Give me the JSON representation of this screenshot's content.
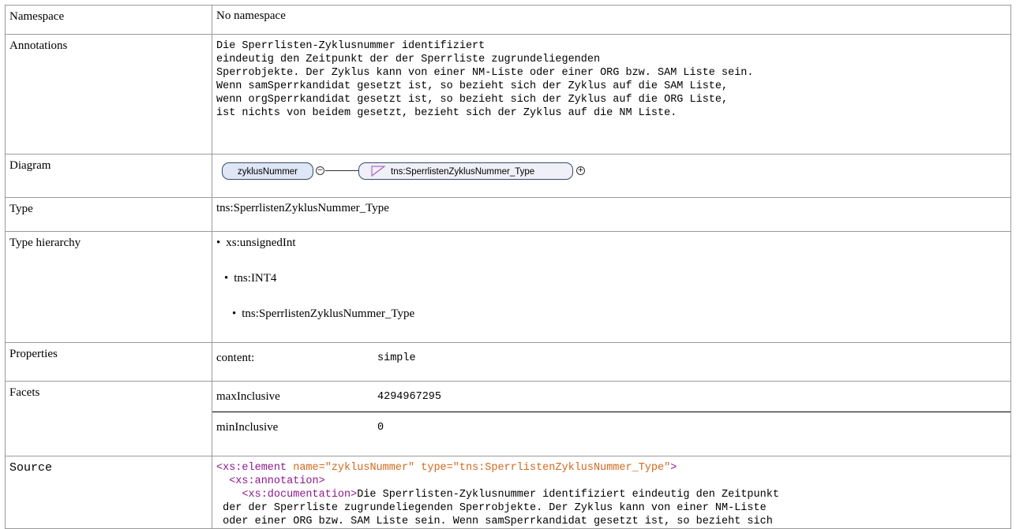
{
  "rows": {
    "namespace": {
      "label": "Namespace",
      "value": "No namespace"
    },
    "annotations": {
      "label": "Annotations",
      "text": "Die Sperrlisten-Zyklusnummer identifiziert\neindeutig den Zeitpunkt der der Sperrliste zugrundeliegenden\nSperrobjekte. Der Zyklus kann von einer NM-Liste oder einer ORG bzw. SAM Liste sein.\nWenn samSperrkandidat gesetzt ist, so bezieht sich der Zyklus auf die SAM Liste,\nwenn orgSperrkandidat gesetzt ist, so bezieht sich der Zyklus auf die ORG Liste,\nist nichts von beidem gesetzt, bezieht sich der Zyklus auf die NM Liste."
    },
    "diagram": {
      "label": "Diagram",
      "element": "zyklusNummer",
      "type_box": "tns:SperrlistenZyklusNummer_Type",
      "icons": [
        "minus-icon",
        "plus-icon",
        "simple-type-icon"
      ]
    },
    "type": {
      "label": "Type",
      "value": "tns:SperrlistenZyklusNummer_Type"
    },
    "hierarchy": {
      "label": "Type hierarchy",
      "items": [
        "xs:unsignedInt",
        "tns:INT4",
        "tns:SperrlistenZyklusNummer_Type"
      ]
    },
    "properties": {
      "label": "Properties",
      "key": "content:",
      "value": "simple"
    },
    "facets": {
      "label": "Facets",
      "items": [
        {
          "key": "maxInclusive",
          "value": "4294967295"
        },
        {
          "key": "minInclusive",
          "value": "0"
        }
      ]
    },
    "source": {
      "label": "Source",
      "line1_open": "<xs:element ",
      "line1_attr1": "name=",
      "line1_val1": "\"zyklusNummer\"",
      "line1_attr2": " type=",
      "line1_val2": "\"tns:SperrlistenZyklusNummer_Type\"",
      "line1_close": ">",
      "line2": "  <xs:annotation>",
      "line3_tag": "    <xs:documentation>",
      "line3_text": "Die Sperrlisten-Zyklusnummer identifiziert eindeutig den Zeitpunkt",
      "line4": " der der Sperrliste zugrundeliegenden Sperrobjekte. Der Zyklus kann von einer NM-Liste",
      "line5": " oder einer ORG bzw. SAM Liste sein. Wenn samSperrkandidat gesetzt ist, so bezieht sich"
    }
  },
  "colors": {
    "tag": "#8b1a8b",
    "attribute": "#d2691e",
    "string": "#0000cc",
    "pill_fill": "#dfe6f6",
    "border": "#9a9a9a"
  }
}
